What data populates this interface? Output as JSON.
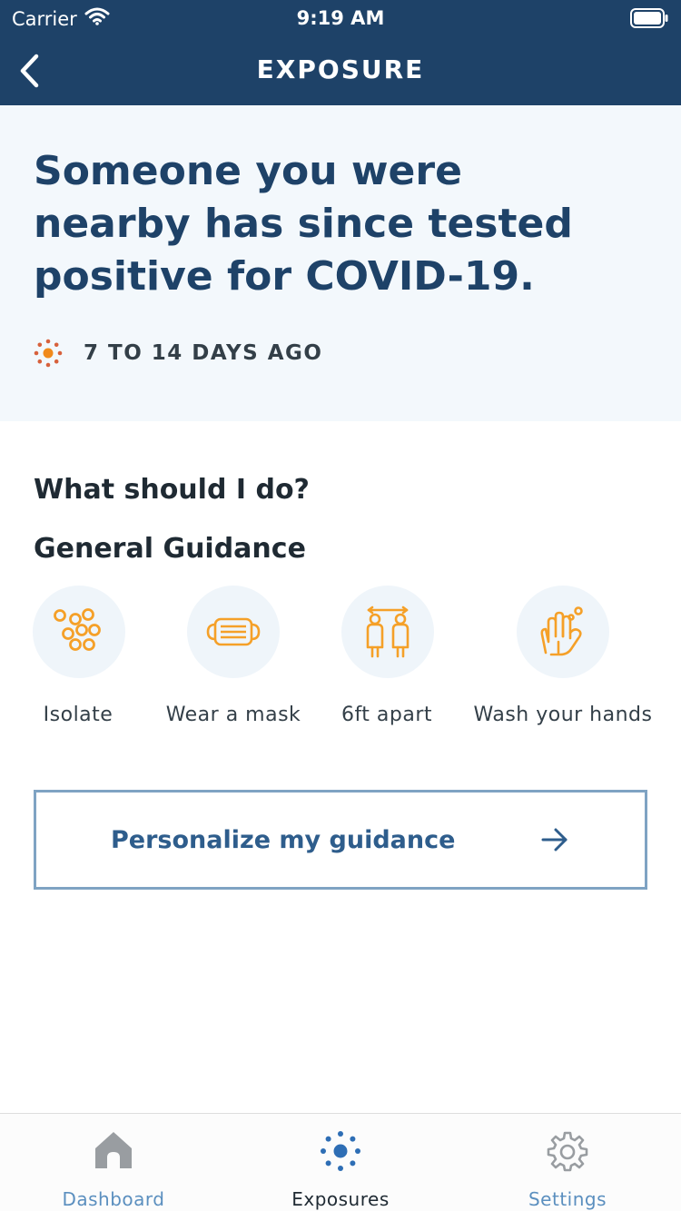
{
  "status_bar": {
    "carrier": "Carrier",
    "time": "9:19 AM"
  },
  "nav": {
    "title": "EXPOSURE"
  },
  "hero": {
    "headline": "Someone you were nearby has since tested positive for COVID-19.",
    "exposure_window": "7 TO 14 DAYS AGO"
  },
  "guidance": {
    "question": "What should I do?",
    "section_title": "General Guidance",
    "items": [
      {
        "label": "Isolate",
        "icon": "isolate-icon"
      },
      {
        "label": "Wear a mask",
        "icon": "mask-icon"
      },
      {
        "label": "6ft apart",
        "icon": "distance-icon"
      },
      {
        "label": "Wash your hands",
        "icon": "wash-hands-icon"
      }
    ],
    "cta_label": "Personalize my guidance"
  },
  "tabs": [
    {
      "label": "Dashboard",
      "icon": "home-icon",
      "selected": false
    },
    {
      "label": "Exposures",
      "icon": "exposures-icon",
      "selected": true
    },
    {
      "label": "Settings",
      "icon": "gear-icon",
      "selected": false
    }
  ],
  "colors": {
    "header": "#1e4268",
    "accent_orange": "#f5a028",
    "tab_active": "#1f2a33",
    "tab_inactive": "#5b8fbf"
  }
}
